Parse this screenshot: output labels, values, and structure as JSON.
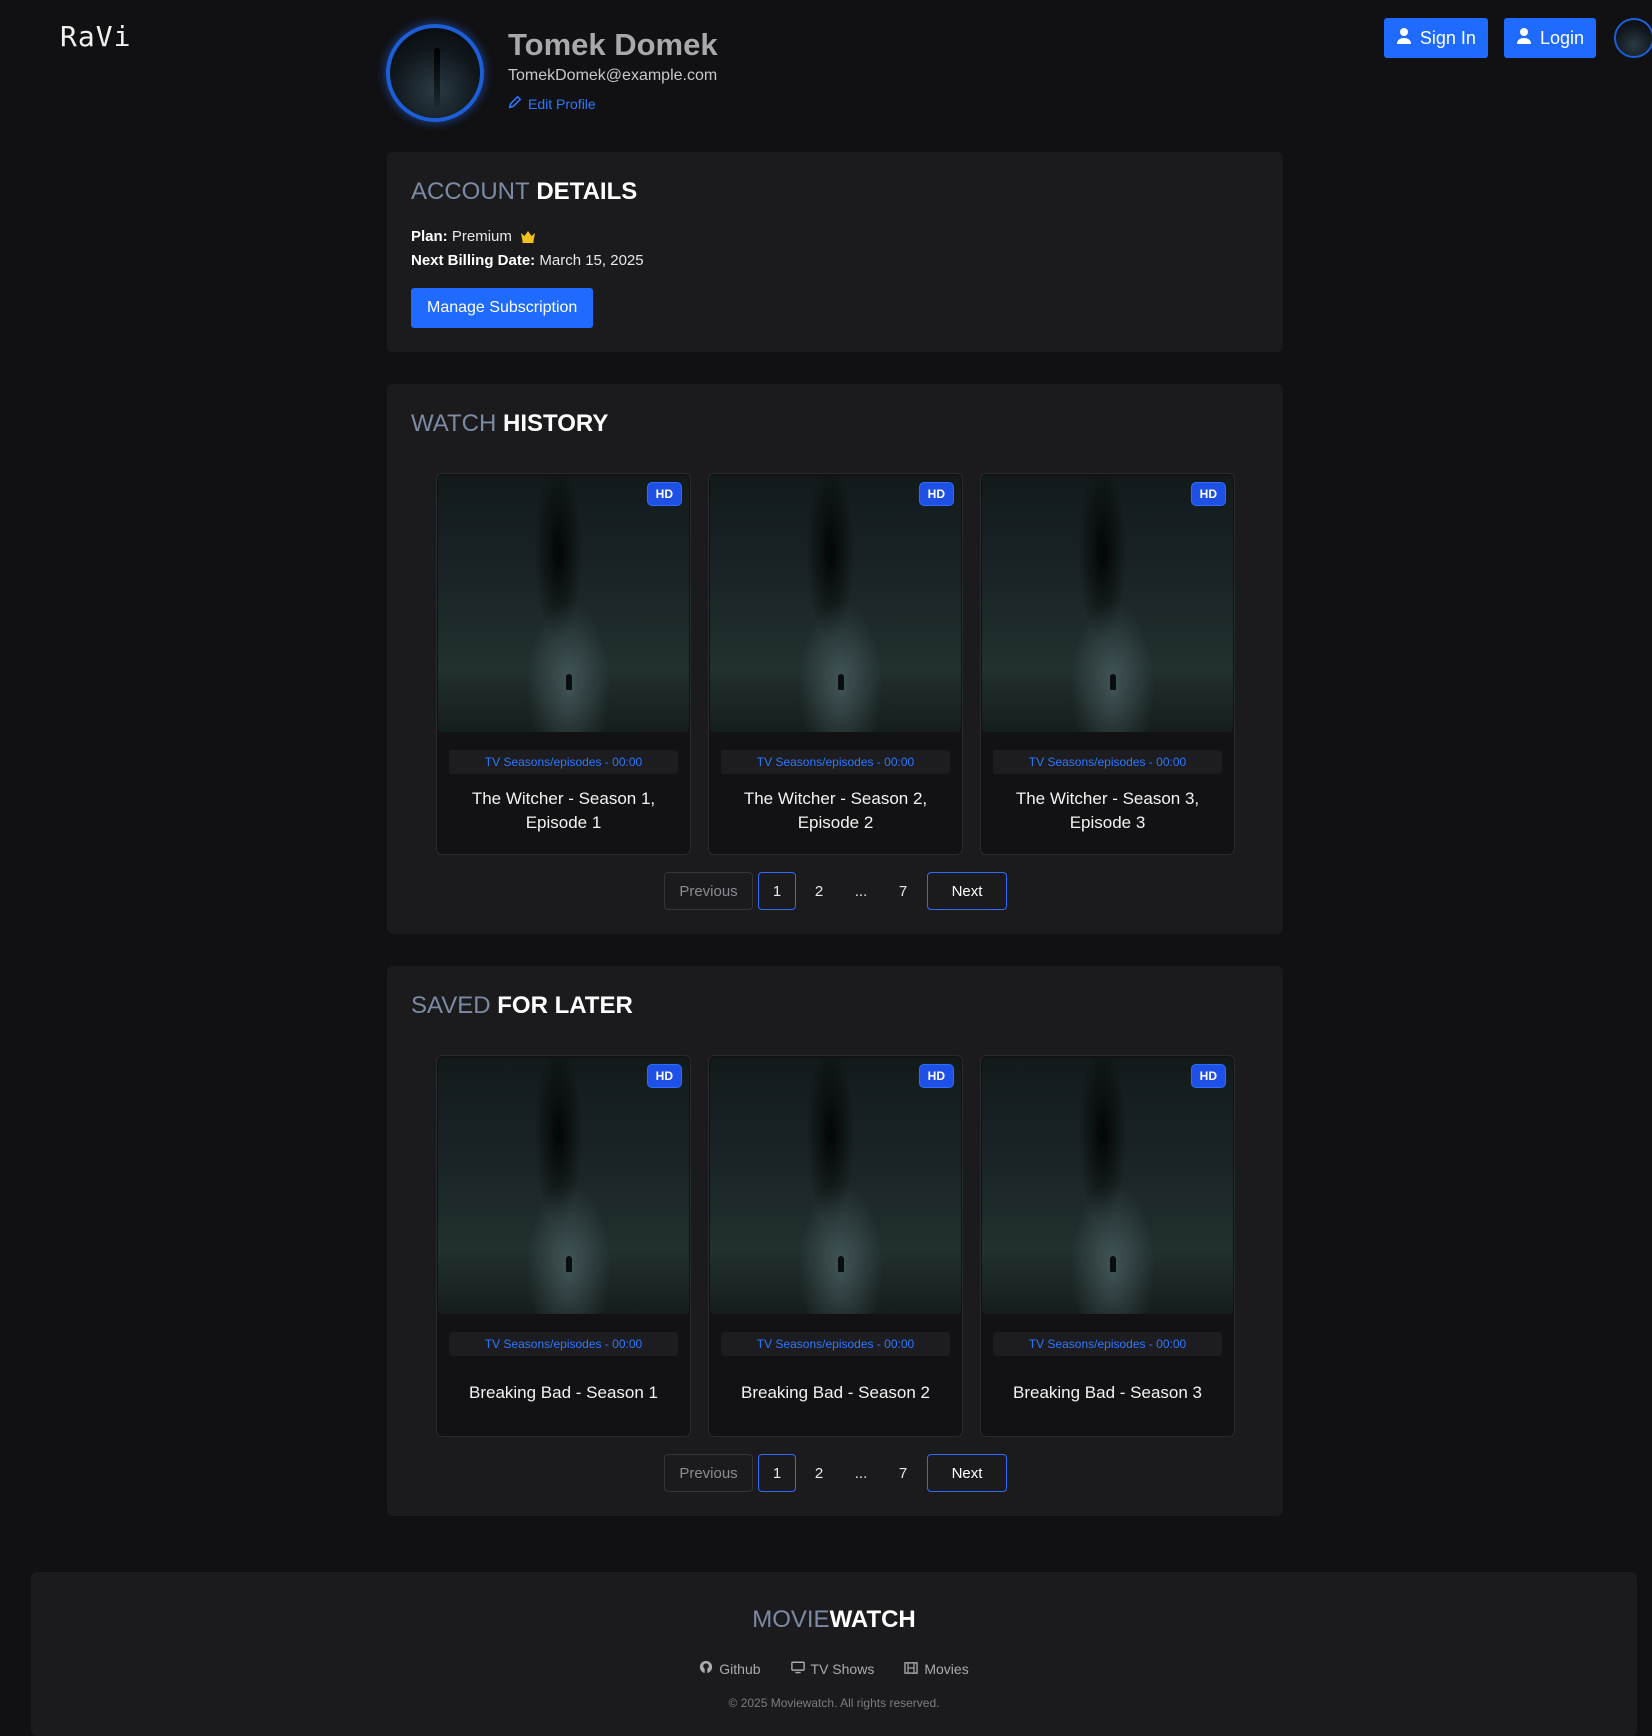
{
  "header": {
    "brand": "RaVi",
    "sign_in_label": "Sign In",
    "login_label": "Login"
  },
  "profile": {
    "name": "Tomek Domek",
    "email": "TomekDomek@example.com",
    "edit_label": "Edit Profile"
  },
  "account": {
    "title_light": "ACCOUNT",
    "title_bold": "DETAILS",
    "plan_label": "Plan:",
    "plan_value": "Premium",
    "billing_label": "Next Billing Date:",
    "billing_value": "March 15, 2025",
    "manage_label": "Manage Subscription"
  },
  "history": {
    "title_light": "WATCH",
    "title_bold": "HISTORY",
    "cards": [
      {
        "badge": "HD",
        "meta": "TV Seasons/episodes - 00:00",
        "title": "The Witcher - Season 1, Episode 1"
      },
      {
        "badge": "HD",
        "meta": "TV Seasons/episodes - 00:00",
        "title": "The Witcher - Season 2, Episode 2"
      },
      {
        "badge": "HD",
        "meta": "TV Seasons/episodes - 00:00",
        "title": "The Witcher - Season 3, Episode 3"
      }
    ],
    "pager": {
      "prev": "Previous",
      "pages": [
        "1",
        "2",
        "...",
        "7"
      ],
      "next": "Next"
    }
  },
  "saved": {
    "title_light": "SAVED",
    "title_bold": "FOR LATER",
    "cards": [
      {
        "badge": "HD",
        "meta": "TV Seasons/episodes - 00:00",
        "title": "Breaking Bad - Season 1"
      },
      {
        "badge": "HD",
        "meta": "TV Seasons/episodes - 00:00",
        "title": "Breaking Bad - Season 2"
      },
      {
        "badge": "HD",
        "meta": "TV Seasons/episodes - 00:00",
        "title": "Breaking Bad - Season 3"
      }
    ],
    "pager": {
      "prev": "Previous",
      "pages": [
        "1",
        "2",
        "...",
        "7"
      ],
      "next": "Next"
    }
  },
  "footer": {
    "logo_light": "MOVIE",
    "logo_bold": "WATCH",
    "links": [
      {
        "label": "Github",
        "icon": "github-icon"
      },
      {
        "label": "TV Shows",
        "icon": "tv-icon"
      },
      {
        "label": "Movies",
        "icon": "film-icon"
      }
    ],
    "copyright": "© 2025 Moviewatch. All rights reserved."
  },
  "colors": {
    "accent": "#1f6bff",
    "background": "#111113",
    "panel": "#1b1b1e"
  }
}
